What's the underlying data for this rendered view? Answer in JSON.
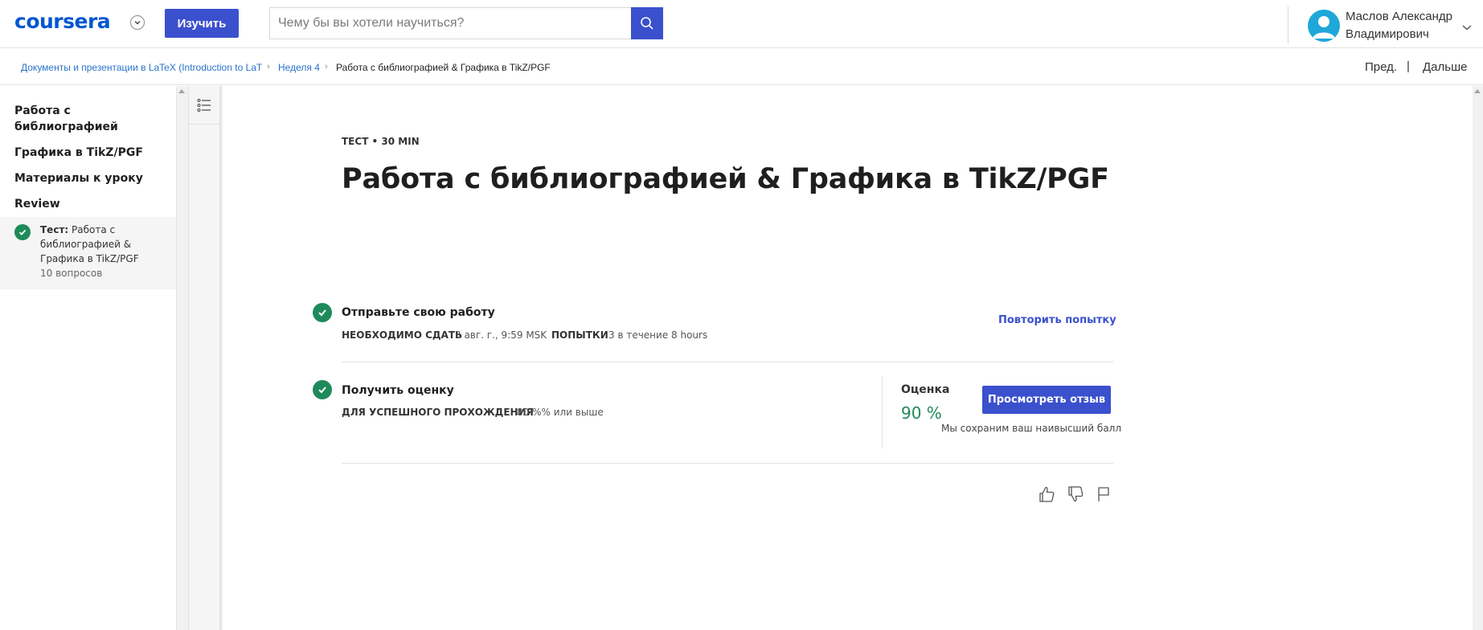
{
  "header": {
    "logo_text": "coursera",
    "explore_label": "Изучить",
    "search_placeholder": "Чему бы вы хотели научиться?",
    "user_name": "Маслов Александр Владимирович",
    "brand_color": "#0056d2",
    "accent_color": "#3b50cd",
    "icons": [
      "chevron-down-icon",
      "search-icon",
      "avatar-icon"
    ]
  },
  "breadcrumb": {
    "course": "Документы и презентации в LaTeX (Introduction to LaT",
    "week": "Неделя 4",
    "current": "Работа с библиографией & Графика в TikZ/PGF",
    "separator": "›"
  },
  "pager": {
    "prev": "Пред.",
    "separator": "|",
    "next": "Дальше"
  },
  "sidebar": {
    "items": [
      {
        "label": "Работа с библиографией"
      },
      {
        "label": "Графика в TikZ/PGF"
      },
      {
        "label": "Материалы к уроку"
      },
      {
        "label": "Review"
      }
    ],
    "active": {
      "prefix": "Тест:",
      "label": "Работа с библиографией & Графика в TikZ/PGF",
      "count": "10 вопросов"
    }
  },
  "main": {
    "kicker": "ТЕСТ • 30 MIN",
    "title": "Работа с библиографией & Графика в TikZ/PGF",
    "submit": {
      "title": "Отправьте свою работу",
      "due_label": "НЕОБХОДИМО СДАТЬ",
      "due_value": "3 авг. г., 9:59 MSK",
      "attempts_label": "ПОПЫТКИ",
      "attempts_value": "3 в течение 8 hours",
      "retry_label": "Повторить попытку"
    },
    "grade": {
      "title": "Получить оценку",
      "pass_label": "ДЛЯ УСПЕШНОГО ПРОХОЖДЕНИЯ",
      "pass_value": "80 %% или выше",
      "grade_label": "Оценка",
      "grade_value": "90 %",
      "feedback_label": "Просмотреть отзыв",
      "keep_note": "Мы сохраним ваш наивысший балл",
      "success_color": "#1e8a5a"
    },
    "feedback_icons": [
      "thumbs-up-icon",
      "thumbs-down-icon",
      "flag-icon"
    ]
  }
}
